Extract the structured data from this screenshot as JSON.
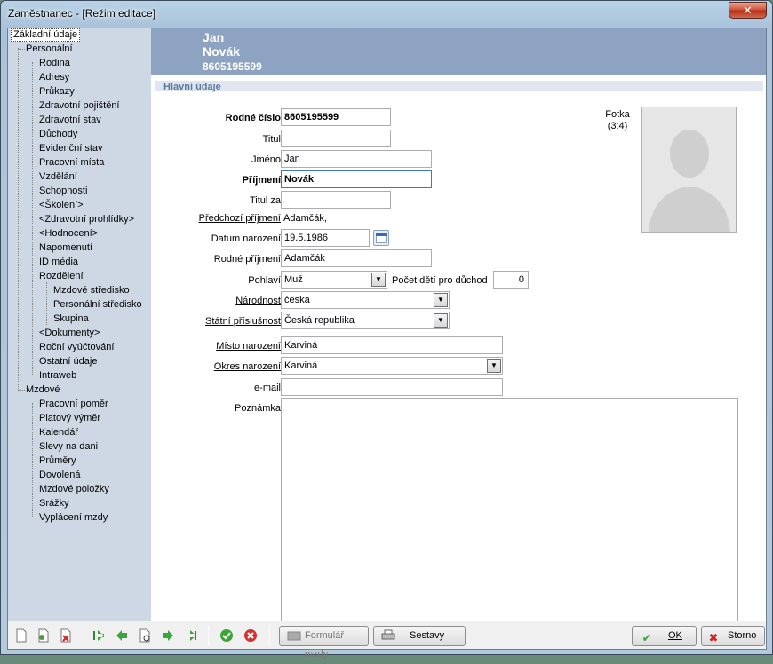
{
  "window": {
    "title": "Zaměstnanec - [Režim editace]",
    "close_glyph": "✕"
  },
  "sidebar": {
    "items": [
      {
        "label": "Základní údaje"
      },
      {
        "label": "Personální"
      },
      {
        "label": "Rodina"
      },
      {
        "label": "Adresy"
      },
      {
        "label": "Průkazy"
      },
      {
        "label": "Zdravotní pojištění"
      },
      {
        "label": "Zdravotní stav"
      },
      {
        "label": "Důchody"
      },
      {
        "label": "Evidenční stav"
      },
      {
        "label": "Pracovní místa"
      },
      {
        "label": "Vzdělání"
      },
      {
        "label": "Schopnosti"
      },
      {
        "label": "<Školení>"
      },
      {
        "label": "<Zdravotní prohlídky>"
      },
      {
        "label": "<Hodnocení>"
      },
      {
        "label": "Napomenutí"
      },
      {
        "label": "ID média"
      },
      {
        "label": "Rozdělení"
      },
      {
        "label": "Mzdové středisko"
      },
      {
        "label": "Personální středisko"
      },
      {
        "label": "Skupina"
      },
      {
        "label": "<Dokumenty>"
      },
      {
        "label": "Roční vyúčtování"
      },
      {
        "label": "Ostatní údaje"
      },
      {
        "label": "Intraweb"
      },
      {
        "label": "Mzdové"
      },
      {
        "label": "Pracovní poměr"
      },
      {
        "label": "Platový výměr"
      },
      {
        "label": "Kalendář"
      },
      {
        "label": "Slevy na dani"
      },
      {
        "label": "Průměry"
      },
      {
        "label": "Dovolená"
      },
      {
        "label": "Mzdové položky"
      },
      {
        "label": "Srážky"
      },
      {
        "label": "Vyplácení mzdy"
      }
    ]
  },
  "header": {
    "first_name": "Jan",
    "last_name": "Novák",
    "id": "8605195599"
  },
  "section": {
    "title": "Hlavní údaje"
  },
  "form": {
    "rodne_cislo": {
      "label": "Rodné číslo",
      "value": "8605195599"
    },
    "titul": {
      "label": "Titul",
      "value": ""
    },
    "jmeno": {
      "label": "Jméno",
      "value": "Jan"
    },
    "prijmeni": {
      "label": "Příjmení",
      "value": "Novák"
    },
    "titul_za": {
      "label": "Titul za",
      "value": ""
    },
    "predchozi_prijmeni": {
      "label": "Předchozí příjmení",
      "value": "Adamčák,"
    },
    "datum_narozeni": {
      "label": "Datum narození",
      "value": "19.5.1986"
    },
    "rodne_prijmeni": {
      "label": "Rodné příjmení",
      "value": "Adamčák"
    },
    "pohlavi": {
      "label": "Pohlaví",
      "value": "Muž"
    },
    "pocet_deti": {
      "label": "Počet dětí pro důchod",
      "value": "0"
    },
    "narodnost": {
      "label": "Národnost",
      "value": "česká"
    },
    "statni_prislusnost": {
      "label": "Státní příslušnost",
      "value": "Česká republika"
    },
    "misto_narozeni": {
      "label": "Místo narození",
      "value": "Karviná"
    },
    "okres_narozeni": {
      "label": "Okres narození",
      "value": "Karviná"
    },
    "email": {
      "label": "e-mail",
      "value": ""
    },
    "poznamka": {
      "label": "Poznámka",
      "value": ""
    }
  },
  "photo": {
    "label_line1": "Fotka",
    "label_line2": "(3:4)"
  },
  "dropdown_glyph": "▼",
  "toolbar": {
    "formular_label": "Formulář mzdy",
    "sestavy_label": "Sestavy",
    "ok_label": "OK",
    "storno_label": "Storno"
  },
  "colors": {
    "header_band": "#8ea3c1",
    "sidebar_bg": "#ced8e4",
    "section_title": "#5a7a9e"
  }
}
